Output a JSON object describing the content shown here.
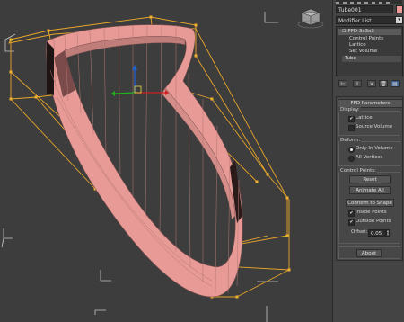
{
  "command_panel": {
    "object_name": "Tube001",
    "object_color": "#f19a97",
    "modifier_list_label": "Modifier List",
    "stack": {
      "top": "FFD 3x3x3",
      "subs": [
        "Control Points",
        "Lattice",
        "Set Volume"
      ],
      "base": "Tube"
    },
    "tool_icons": [
      "pin-stack-icon",
      "show-end-result-icon",
      "make-unique-icon",
      "remove-modifier-icon",
      "configure-modifier-sets-icon"
    ]
  },
  "ffd_params": {
    "title": "FFD Parameters",
    "display": {
      "label": "Display:",
      "lattice": "Lattice",
      "lattice_checked": true,
      "source_volume": "Source Volume",
      "source_volume_checked": false
    },
    "deform": {
      "label": "Deform:",
      "only_in_volume": "Only In Volume",
      "all_vertices": "All Vertices",
      "selected": "only_in_volume"
    },
    "control_points": {
      "label": "Control Points:",
      "reset": "Reset",
      "animate_all": "Animate All",
      "conform": "Conform to Shape",
      "inside_points": "Inside Points",
      "inside_checked": true,
      "outside_points": "Outside Points",
      "outside_checked": true,
      "offset_label": "Offset:",
      "offset_value": "0.05"
    },
    "about": "About"
  },
  "viewport": {
    "object_color": "#e79a96",
    "lattice_color": "#e8a52a",
    "grid_color": "#c9c9c9"
  }
}
